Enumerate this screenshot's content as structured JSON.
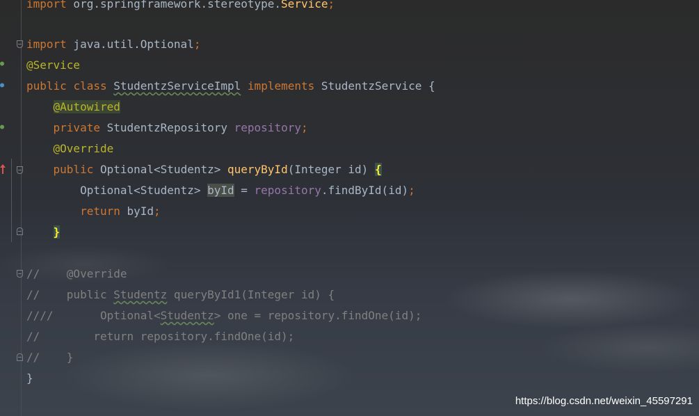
{
  "colors": {
    "keyword": "#cc7832",
    "annotation": "#bbb529",
    "field": "#9876aa",
    "method": "#ffc66d",
    "comment": "#808080",
    "default_text": "#a9b7c6"
  },
  "code": {
    "l0": {
      "kw": "import",
      "rest": " org.springframework.stereotype.",
      "cls": "Service",
      "semi": ";"
    },
    "l2": {
      "kw": "import",
      "rest": " java.util.Optional",
      "semi": ";"
    },
    "l3": {
      "ann": "@Service"
    },
    "l4": {
      "kw1": "public",
      "kw2": "class",
      "cls": "StudentzServiceImpl",
      "kw3": "implements",
      "iface": "StudentzService",
      "brace": "{"
    },
    "l5": {
      "ann": "@Autowired"
    },
    "l6": {
      "kw": "private",
      "type": "StudentzRepository",
      "field": "repository",
      "semi": ";"
    },
    "l7": {
      "ann": "@Override"
    },
    "l8": {
      "kw": "public",
      "type": "Optional<Studentz>",
      "method": "queryById",
      "params": "(Integer id)",
      "brace": "{"
    },
    "l9": {
      "type": "Optional<Studentz>",
      "var": "byId",
      "eq": " = ",
      "field": "repository",
      "call": ".findById(id)",
      "semi": ";"
    },
    "l10": {
      "kw": "return",
      "rest": " byId",
      "semi": ";"
    },
    "l11": {
      "brace": "}"
    },
    "l13": {
      "text": "//    @Override"
    },
    "l14": {
      "pre": "//    public ",
      "cls": "Studentz",
      "post": " queryById1(Integer id) {"
    },
    "l15": {
      "pre": "////       Optional<",
      "cls": "Studentz",
      "post": "> one = repository.findOne(id);"
    },
    "l16": {
      "text": "//        return repository.findOne(id);"
    },
    "l17": {
      "text": "//    }"
    },
    "l18": {
      "text": "}"
    }
  },
  "watermark": "https://blog.csdn.net/weixin_45597291"
}
